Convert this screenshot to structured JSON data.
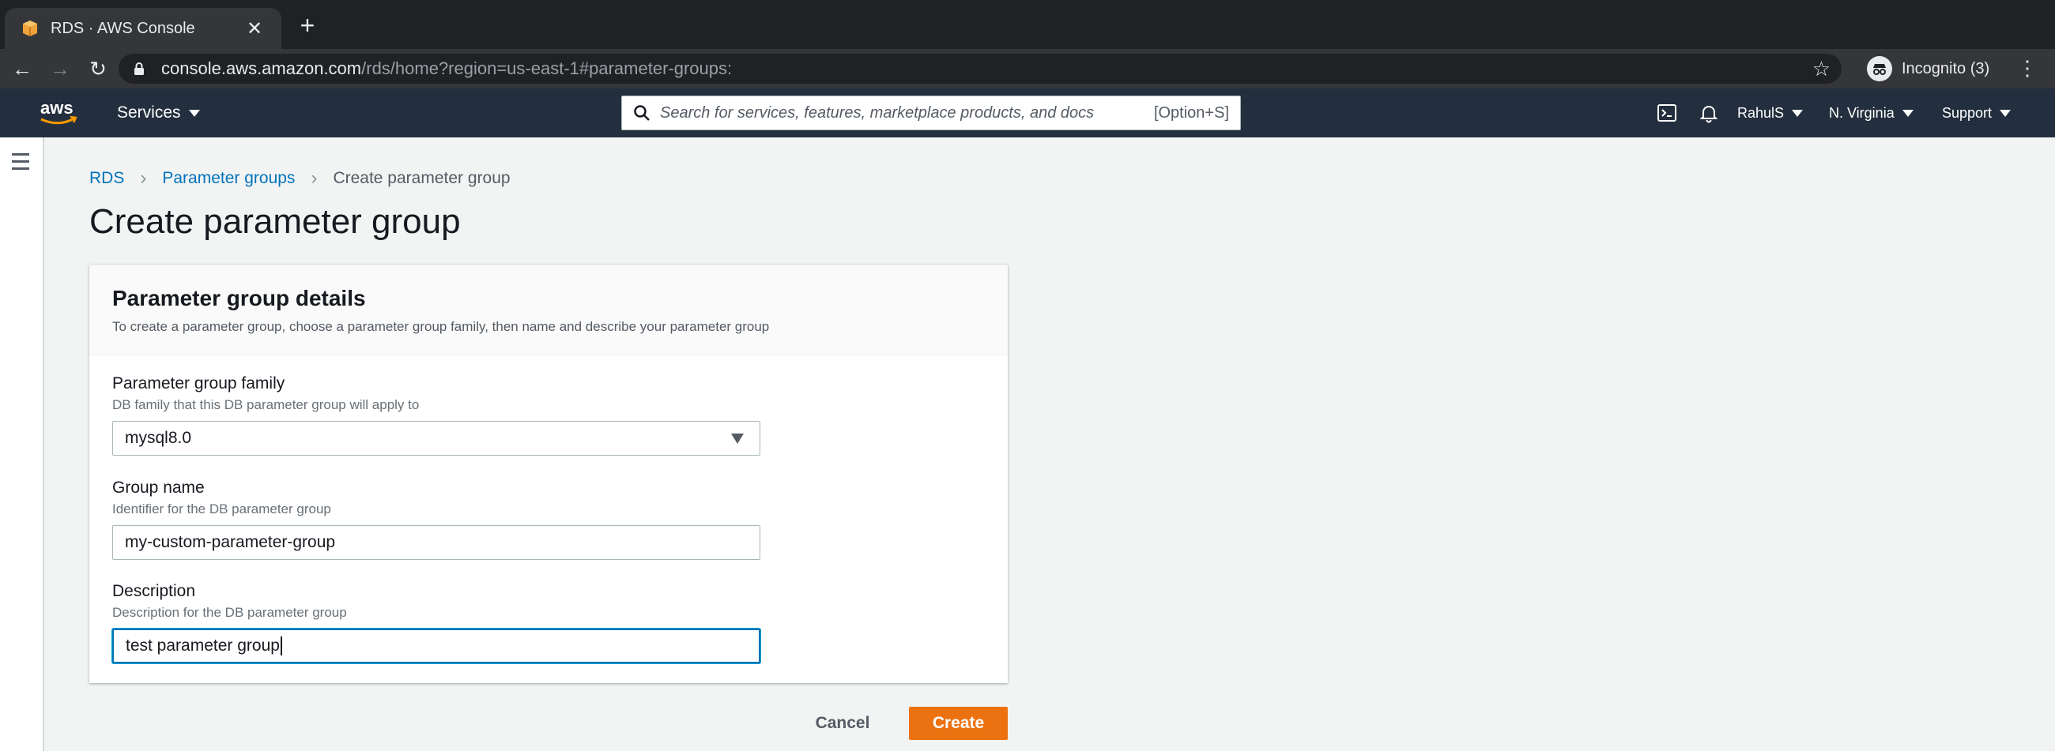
{
  "browser": {
    "tab_title": "RDS · AWS Console",
    "url_host": "console.aws.amazon.com",
    "url_path": "/rds/home?region=us-east-1#parameter-groups:",
    "incognito_label": "Incognito (3)"
  },
  "aws_nav": {
    "services_label": "Services",
    "search_placeholder": "Search for services, features, marketplace products, and docs",
    "search_shortcut": "[Option+S]",
    "user": "RahulS",
    "region": "N. Virginia",
    "support": "Support"
  },
  "breadcrumb": {
    "root": "RDS",
    "parent": "Parameter groups",
    "current": "Create parameter group"
  },
  "page_title": "Create parameter group",
  "panel": {
    "title": "Parameter group details",
    "description": "To create a parameter group, choose a parameter group family, then name and describe your parameter group",
    "family": {
      "label": "Parameter group family",
      "hint": "DB family that this DB parameter group will apply to",
      "value": "mysql8.0"
    },
    "group_name": {
      "label": "Group name",
      "hint": "Identifier for the DB parameter group",
      "value": "my-custom-parameter-group"
    },
    "description_field": {
      "label": "Description",
      "hint": "Description for the DB parameter group",
      "value": "test parameter group"
    }
  },
  "actions": {
    "cancel": "Cancel",
    "create": "Create"
  },
  "colors": {
    "aws_nav_bg": "#232f3e",
    "primary_button": "#ec7211",
    "link": "#0073bb",
    "focus": "#0073bb"
  }
}
